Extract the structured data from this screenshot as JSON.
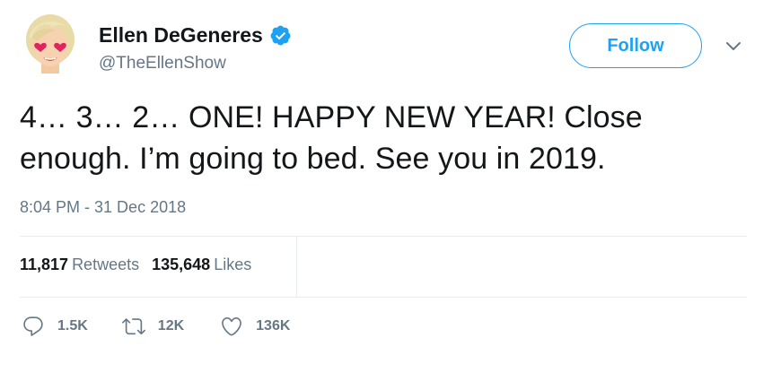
{
  "user": {
    "name": "Ellen DeGeneres",
    "handle": "@TheEllenShow",
    "verified": true
  },
  "follow_button": {
    "label": "Follow"
  },
  "tweet": {
    "text": "4… 3… 2… ONE! HAPPY NEW YEAR! Close enough. I’m going to bed. See you in 2019.",
    "timestamp": "8:04 PM - 31 Dec 2018"
  },
  "stats": {
    "retweets_count": "11,817",
    "retweets_label": "Retweets",
    "likes_count": "135,648",
    "likes_label": "Likes"
  },
  "actions": {
    "reply_count": "1.5K",
    "retweet_count": "12K",
    "like_count": "136K"
  },
  "colors": {
    "accent": "#1da1f2",
    "secondary_text": "#657786",
    "primary_text": "#14171a",
    "divider": "#e6ecf0"
  },
  "icons": {
    "avatar": "ellen-heart-eyes-emoji-avatar",
    "verified": "verified-badge-icon",
    "more": "chevron-down-icon",
    "reply": "reply-bubble-icon",
    "retweet": "retweet-icon",
    "like": "heart-outline-icon"
  }
}
